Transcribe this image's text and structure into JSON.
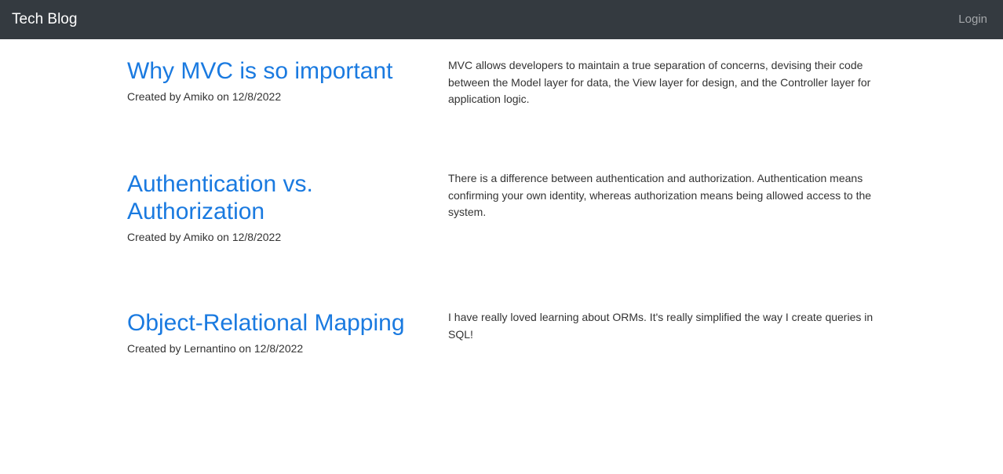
{
  "navbar": {
    "brand": "Tech Blog",
    "login_label": "Login"
  },
  "posts": [
    {
      "title": "Why MVC is so important",
      "meta": "Created by Amiko on 12/8/2022",
      "body": "MVC allows developers to maintain a true separation of concerns, devising their code between the Model layer for data, the View layer for design, and the Controller layer for application logic."
    },
    {
      "title": "Authentication vs. Authorization",
      "meta": "Created by Amiko on 12/8/2022",
      "body": "There is a difference between authentication and authorization. Authentication means confirming your own identity, whereas authorization means being allowed access to the system."
    },
    {
      "title": "Object-Relational Mapping",
      "meta": "Created by Lernantino on 12/8/2022",
      "body": "I have really loved learning about ORMs. It's really simplified the way I create queries in SQL!"
    }
  ],
  "colors": {
    "navbar_bg": "#343a40",
    "title_link": "#1a7ae0",
    "text": "#333333"
  }
}
